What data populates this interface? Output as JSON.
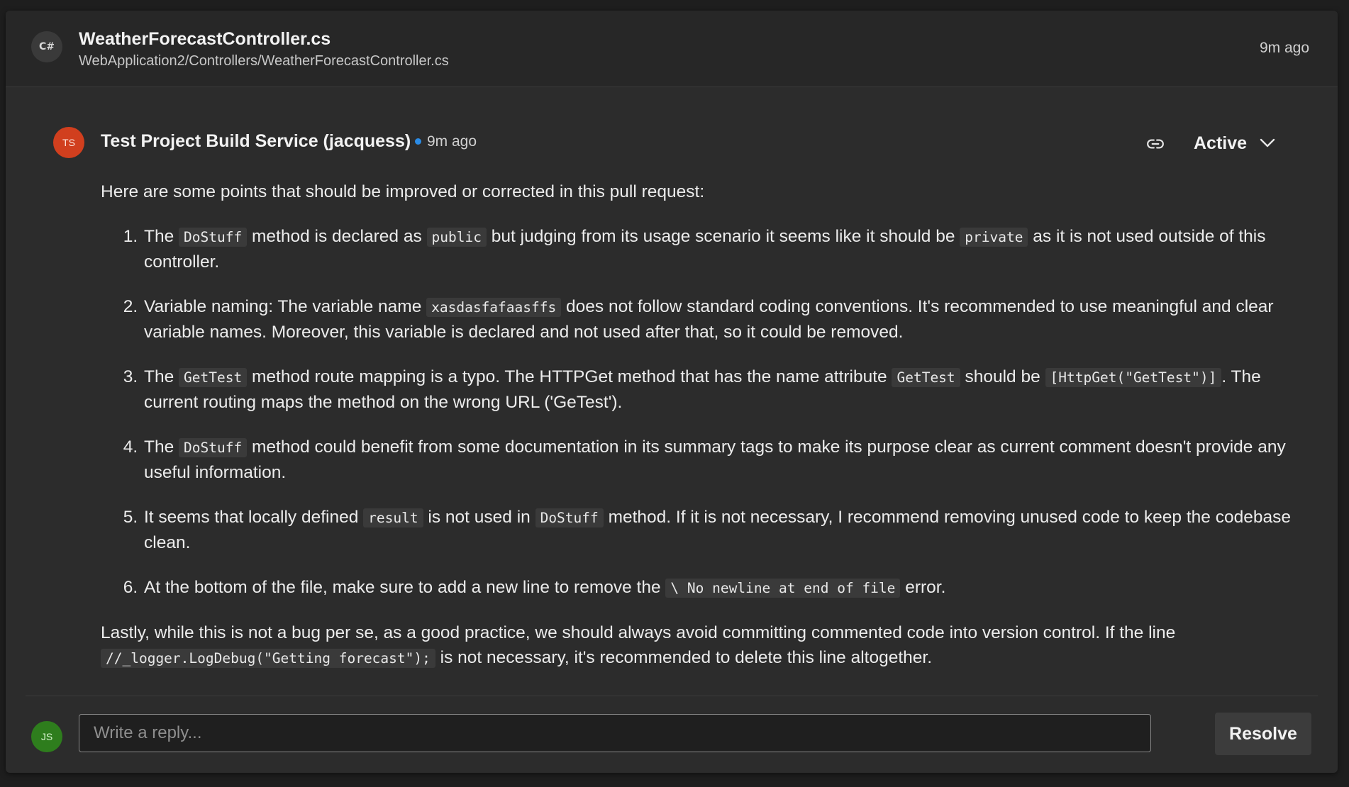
{
  "file": {
    "language_badge": "C#",
    "name": "WeatherForecastController.cs",
    "path": "WebApplication2/Controllers/WeatherForecastController.cs",
    "time": "9m ago"
  },
  "comment": {
    "author_initials": "TS",
    "author_name": "Test Project Build Service (jacquess)",
    "time": "9m ago",
    "status": "Active",
    "intro": "Here are some points that should be improved or corrected in this pull request:",
    "items": [
      {
        "t1": "The ",
        "c1": "DoStuff",
        "t2": " method is declared as ",
        "c2": "public",
        "t3": " but judging from its usage scenario it seems like it should be ",
        "c3": "private",
        "t4": " as it is not used outside of this controller."
      },
      {
        "t1": "Variable naming: The variable name ",
        "c1": "xasdasfafaasffs",
        "t2": " does not follow standard coding conventions. It's recommended to use meaningful and clear variable names. Moreover, this variable is declared and not used after that, so it could be removed."
      },
      {
        "t1": "The ",
        "c1": "GetTest",
        "t2": " method route mapping is a typo. The HTTPGet method that has the name attribute ",
        "c2": "GetTest",
        "t3": " should be ",
        "c3": "[HttpGet(\"GetTest\")]",
        "t4": ". The current routing maps the method on the wrong URL ('GeTest')."
      },
      {
        "t1": "The ",
        "c1": "DoStuff",
        "t2": " method could benefit from some documentation in its summary tags to make its purpose clear as current comment doesn't provide any useful information."
      },
      {
        "t1": "It seems that locally defined ",
        "c1": "result",
        "t2": " is not used in ",
        "c2": "DoStuff",
        "t3": " method. If it is not necessary, I recommend removing unused code to keep the codebase clean."
      },
      {
        "t1": "At the bottom of the file, make sure to add a new line to remove the ",
        "c1": "\\ No newline at end of file",
        "t2": " error."
      }
    ],
    "outro_t1": "Lastly, while this is not a bug per se, as a good practice, we should always avoid committing commented code into version control. If the line ",
    "outro_c1": "//_logger.LogDebug(\"Getting forecast\");",
    "outro_t2": " is not necessary, it's recommended to delete this line altogether."
  },
  "reply": {
    "avatar_initials": "JS",
    "placeholder": "Write a reply...",
    "resolve_label": "Resolve"
  },
  "icons": {
    "link": "link-icon",
    "chevron": "chevron-down-icon"
  },
  "colors": {
    "author_avatar": "#d13f1e",
    "reply_avatar": "#2e7d1d",
    "unread_dot": "#2b8ce6"
  }
}
